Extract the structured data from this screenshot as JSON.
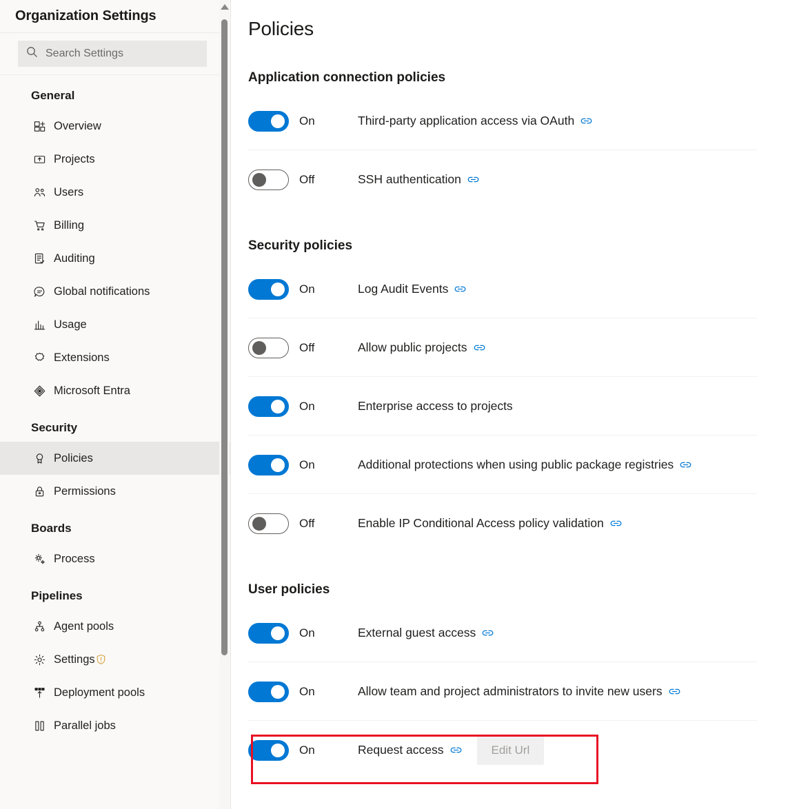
{
  "sidebar": {
    "title": "Organization Settings",
    "search": {
      "placeholder": "Search Settings",
      "value": "",
      "icon": "search-icon"
    },
    "groups": [
      {
        "title": "General",
        "items": [
          {
            "label": "Overview",
            "icon": "overview-icon",
            "selected": false
          },
          {
            "label": "Projects",
            "icon": "projects-icon",
            "selected": false
          },
          {
            "label": "Users",
            "icon": "users-icon",
            "selected": false
          },
          {
            "label": "Billing",
            "icon": "billing-cart-icon",
            "selected": false
          },
          {
            "label": "Auditing",
            "icon": "auditing-icon",
            "selected": false
          },
          {
            "label": "Global notifications",
            "icon": "notification-bubble-icon",
            "selected": false
          },
          {
            "label": "Usage",
            "icon": "usage-chart-icon",
            "selected": false
          },
          {
            "label": "Extensions",
            "icon": "extensions-icon",
            "selected": false
          },
          {
            "label": "Microsoft Entra",
            "icon": "microsoft-entra-icon",
            "selected": false
          }
        ]
      },
      {
        "title": "Security",
        "items": [
          {
            "label": "Policies",
            "icon": "policies-ribbon-icon",
            "selected": true
          },
          {
            "label": "Permissions",
            "icon": "lock-icon",
            "selected": false
          }
        ]
      },
      {
        "title": "Boards",
        "items": [
          {
            "label": "Process",
            "icon": "process-gear-icon",
            "selected": false
          }
        ]
      },
      {
        "title": "Pipelines",
        "items": [
          {
            "label": "Agent pools",
            "icon": "agent-pools-icon",
            "selected": false
          },
          {
            "label": "Settings",
            "icon": "gear-icon",
            "selected": false,
            "badge": "warning-shield-icon"
          },
          {
            "label": "Deployment pools",
            "icon": "deployment-pools-icon",
            "selected": false
          },
          {
            "label": "Parallel jobs",
            "icon": "parallel-jobs-icon",
            "selected": false
          }
        ]
      }
    ],
    "scrollbar": {
      "up_arrow": "scroll-up-arrow-icon"
    }
  },
  "main": {
    "page_title": "Policies",
    "sections": [
      {
        "title": "Application connection policies",
        "policies": [
          {
            "state": "On",
            "on": true,
            "label": "Third-party application access via OAuth",
            "link": true,
            "separator": true
          },
          {
            "state": "Off",
            "on": false,
            "label": "SSH authentication",
            "link": true,
            "separator": false
          }
        ]
      },
      {
        "title": "Security policies",
        "policies": [
          {
            "state": "On",
            "on": true,
            "label": "Log Audit Events",
            "link": true,
            "separator": true
          },
          {
            "state": "Off",
            "on": false,
            "label": "Allow public projects",
            "link": true,
            "separator": true
          },
          {
            "state": "On",
            "on": true,
            "label": "Enterprise access to projects",
            "link": false,
            "separator": true
          },
          {
            "state": "On",
            "on": true,
            "label": "Additional protections when using public package registries",
            "link": true,
            "separator": true
          },
          {
            "state": "Off",
            "on": false,
            "label": "Enable IP Conditional Access policy validation",
            "link": true,
            "separator": false
          }
        ]
      },
      {
        "title": "User policies",
        "policies": [
          {
            "state": "On",
            "on": true,
            "label": "External guest access",
            "link": true,
            "separator": true
          },
          {
            "state": "On",
            "on": true,
            "label": "Allow team and project administrators to invite new users",
            "link": true,
            "separator": true
          },
          {
            "state": "On",
            "on": true,
            "label": "Request access",
            "link": true,
            "separator": false,
            "button": "Edit Url",
            "highlighted": true
          }
        ]
      }
    ]
  },
  "colors": {
    "accent_blue": "#0078d4",
    "highlight_red": "#e81123",
    "sidebar_bg": "#faf9f8",
    "selected_bg": "#e9e7e5",
    "warning_gold": "#d6a13d",
    "button_disabled_text": "#a19f9d"
  }
}
